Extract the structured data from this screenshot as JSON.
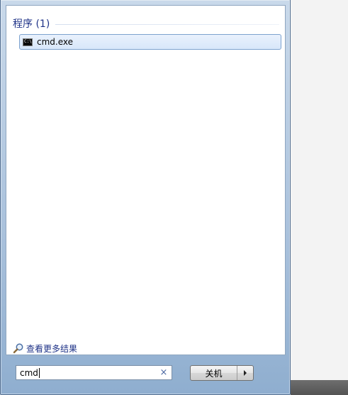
{
  "results": {
    "group_title": "程序 (1)",
    "items": [
      {
        "label": "cmd.exe",
        "icon": "cmd-icon"
      }
    ]
  },
  "see_more": {
    "label": "查看更多结果",
    "icon": "magnifier-icon"
  },
  "search": {
    "value": "cmd",
    "clear_glyph": "×"
  },
  "power": {
    "shutdown_label": "关机"
  },
  "colors": {
    "group_title": "#1e3287",
    "selected_item_border": "#7da2ce",
    "selected_item_bg": "#d8e7fa",
    "menu_frame": "#a9c1dc"
  }
}
